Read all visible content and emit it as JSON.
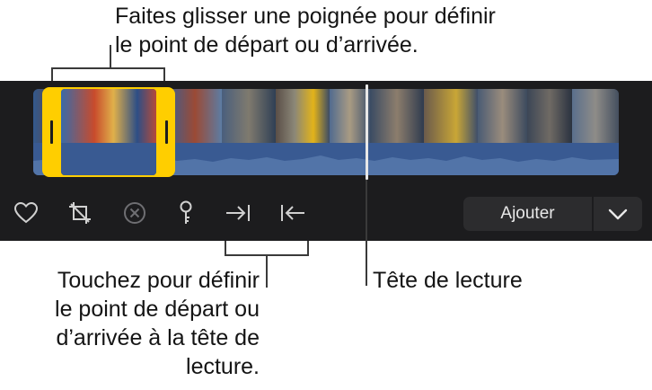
{
  "callouts": {
    "drag_handle": "Faites glisser une poignée pour définir\nle point de départ ou d’arrivée.",
    "set_point_buttons": "Touchez pour définir\nle point de départ ou\nd’arrivée à la tête de\nlecture.",
    "playhead": "Tête de lecture"
  },
  "toolbar": {
    "icons": [
      "heart-icon",
      "crop-icon",
      "delete-icon",
      "keyframe-icon",
      "set-in-point-icon",
      "set-out-point-icon"
    ],
    "add_label": "Ajouter",
    "add_menu_icon": "chevron-down-icon"
  },
  "colors": {
    "panel_bg": "#1c1c1e",
    "selection": "#ffce00",
    "waveform": "#395a92",
    "button_bg": "#2c2c2e"
  }
}
